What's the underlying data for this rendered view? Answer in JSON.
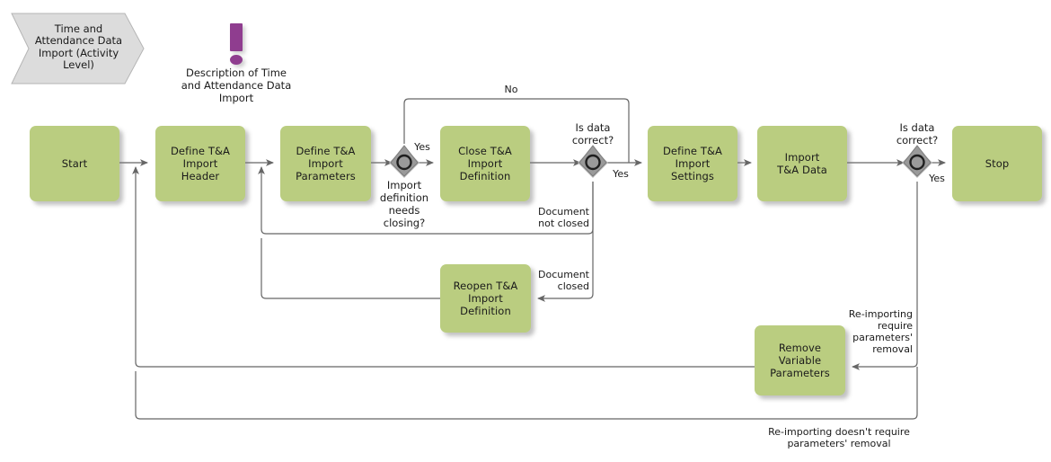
{
  "diagram": {
    "title_banner": {
      "text": "Time and\nAttendance\nData Import\n(Activity\nLevel)",
      "fill": "#dcdcdc"
    },
    "note": {
      "icon": "exclamation-mark-icon",
      "icon_color": "#8f3d8f",
      "text": "Description of Time\nand Attendance Data\nImport"
    },
    "colors": {
      "task_fill": "#bacd80",
      "gateway_fill": "#999999",
      "edge_stroke": "#666666",
      "text": "#1a1a1a"
    },
    "tasks": [
      {
        "id": "start",
        "label": "Start"
      },
      {
        "id": "define-header",
        "label": "Define T&A\nImport\nHeader"
      },
      {
        "id": "define-params",
        "label": "Define T&A\nImport\nParameters"
      },
      {
        "id": "close-def",
        "label": "Close T&A\nImport\nDefinition"
      },
      {
        "id": "define-settings",
        "label": "Define T&A\nImport\nSettings"
      },
      {
        "id": "import-data",
        "label": "Import\nT&A Data"
      },
      {
        "id": "stop",
        "label": "Stop"
      },
      {
        "id": "reopen-def",
        "label": "Reopen T&A\nImport\nDefinition"
      },
      {
        "id": "remove-params",
        "label": "Remove\nVariable\nParameters"
      }
    ],
    "gateways": [
      {
        "id": "gw-closing",
        "label": "Import\ndefinition\nneeds\nclosing?"
      },
      {
        "id": "gw-correct-1",
        "label": "Is data\ncorrect?"
      },
      {
        "id": "gw-correct-2",
        "label": "Is data\ncorrect?"
      }
    ],
    "edge_labels": [
      {
        "id": "lbl-yes-closing",
        "text": "Yes"
      },
      {
        "id": "lbl-no",
        "text": "No"
      },
      {
        "id": "lbl-yes-correct-1",
        "text": "Yes"
      },
      {
        "id": "lbl-yes-correct-2",
        "text": "Yes"
      },
      {
        "id": "lbl-doc-not-closed",
        "text": "Document\nnot closed"
      },
      {
        "id": "lbl-doc-closed",
        "text": "Document\nclosed"
      },
      {
        "id": "lbl-reimport-req",
        "text": "Re-importing\nrequire\nparameters'\nremoval"
      },
      {
        "id": "lbl-reimport-not",
        "text": "Re-importing doesn't require\nparameters' removal"
      }
    ]
  }
}
